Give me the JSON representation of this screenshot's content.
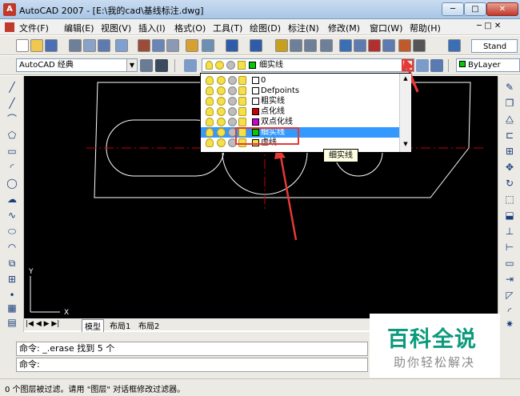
{
  "window": {
    "title": "AutoCAD 2007 - [E:\\我的cad\\基线标注.dwg]",
    "app_icon": "A",
    "minimize": "─",
    "restore": "□",
    "close": "✕"
  },
  "menu": {
    "items": [
      "文件(F)",
      "编辑(E)",
      "视图(V)",
      "插入(I)",
      "格式(O)",
      "工具(T)",
      "绘图(D)",
      "标注(N)",
      "修改(M)",
      "窗口(W)",
      "帮助(H)"
    ]
  },
  "toolbar": {
    "text_style_label": "Stand"
  },
  "workspace": {
    "combo_value": "AutoCAD 经典"
  },
  "layer_toolbar": {
    "current_layer": "细实线",
    "linetype_value": "ByLayer"
  },
  "layer_dropdown": {
    "layers": [
      {
        "name": "0",
        "color": "#ffffff"
      },
      {
        "name": "Defpoints",
        "color": "#ffffff"
      },
      {
        "name": "粗实线",
        "color": "#ffffff"
      },
      {
        "name": "点化线",
        "color": "#cc0000"
      },
      {
        "name": "双点化线",
        "color": "#cc00cc"
      },
      {
        "name": "细实线",
        "color": "#00cc00",
        "selected": true
      },
      {
        "name": "虚线",
        "color": "#f5e04a"
      }
    ],
    "selected_bg": "#3399ff"
  },
  "tooltip": {
    "text": "细实线"
  },
  "drawing": {
    "axis_y": "Y",
    "axis_x": "X"
  },
  "tabs": {
    "items": [
      "模型",
      "布局1",
      "布局2"
    ]
  },
  "command": {
    "line1": "命令: _.erase 找到 5 个",
    "line2": "命令:"
  },
  "status": {
    "text": "0 个图层被过滤。请用 \"图层\" 对话框修改过滤器。"
  },
  "watermark": {
    "title": "百科全说",
    "subtitle": "助你轻松解决"
  },
  "colors": {
    "highlight_red": "#e53935",
    "canvas": "#000000",
    "brand": "#0c9a7c"
  }
}
